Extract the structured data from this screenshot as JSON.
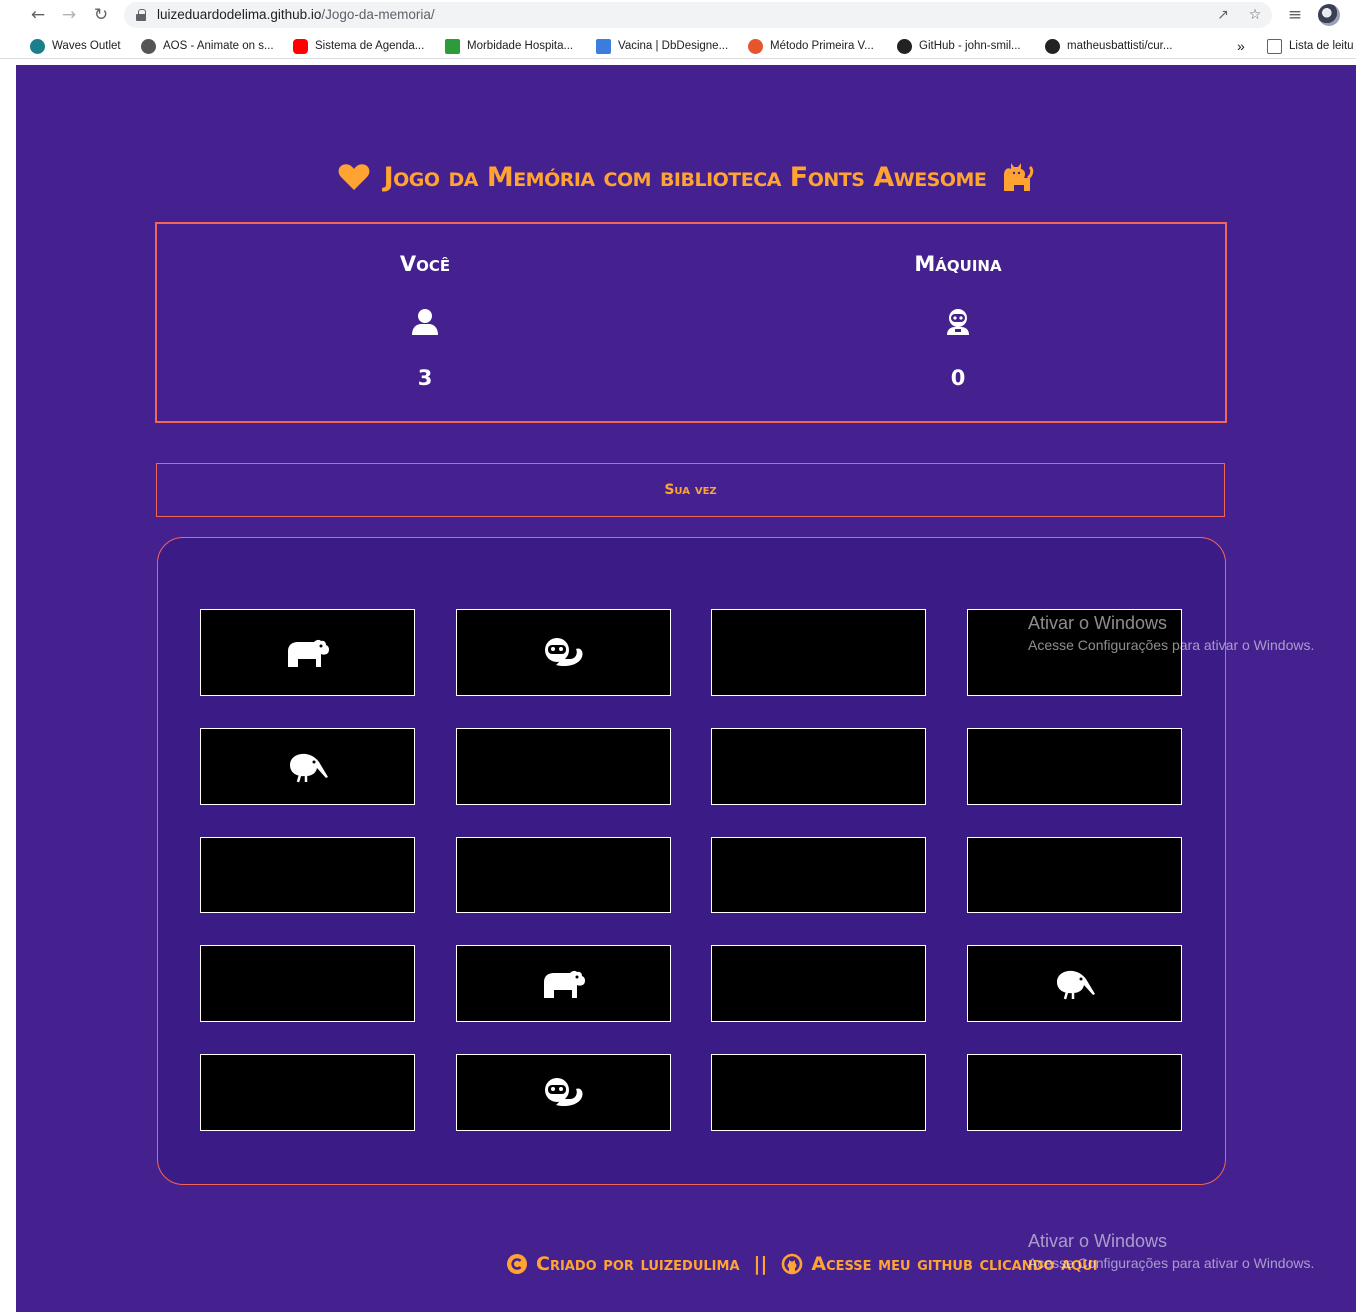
{
  "browser": {
    "url_host": "luizeduardodelima.github.io",
    "url_path": "/Jogo-da-memoria/",
    "bookmarks": [
      {
        "label": "Waves Outlet",
        "color": "#1a7f8a"
      },
      {
        "label": "AOS - Animate on s...",
        "color": "#555555"
      },
      {
        "label": "Sistema de Agenda...",
        "color": "#ff0000"
      },
      {
        "label": "Morbidade Hospita...",
        "color": "#2e9b3a"
      },
      {
        "label": "Vacina | DbDesigne...",
        "color": "#3b7ddd"
      },
      {
        "label": "Método Primeira V...",
        "color": "#e8542c"
      },
      {
        "label": "GitHub - john-smil...",
        "color": "#222222"
      },
      {
        "label": "matheusbattisti/cur...",
        "color": "#222222"
      }
    ],
    "overflow": "»",
    "reading_list": "Lista de leitu"
  },
  "page": {
    "title": "Jogo da Memória com biblioteca Fonts Awesome",
    "accent": "#ffa332",
    "border": "#f2665a",
    "background": "#44218e"
  },
  "score": {
    "player": {
      "name": "Você",
      "icon": "user-icon",
      "value": "3"
    },
    "machine": {
      "name": "Máquina",
      "icon": "robot-icon",
      "value": "0"
    }
  },
  "turn": "Sua vez",
  "cards": [
    {
      "icon": "hippo-icon"
    },
    {
      "icon": "otter-icon"
    },
    {
      "icon": ""
    },
    {
      "icon": ""
    },
    {
      "icon": "kiwi-bird-icon"
    },
    {
      "icon": ""
    },
    {
      "icon": ""
    },
    {
      "icon": ""
    },
    {
      "icon": ""
    },
    {
      "icon": ""
    },
    {
      "icon": ""
    },
    {
      "icon": ""
    },
    {
      "icon": ""
    },
    {
      "icon": "hippo-icon"
    },
    {
      "icon": ""
    },
    {
      "icon": "kiwi-bird-icon"
    },
    {
      "icon": ""
    },
    {
      "icon": "otter-icon"
    },
    {
      "icon": ""
    },
    {
      "icon": ""
    }
  ],
  "footer": {
    "credit": "Criado por luizedulima",
    "separator": "||",
    "github": "Acesse meu github clicando aqui"
  },
  "watermark": {
    "title": "Ativar o Windows",
    "subtitle": "Acesse Configurações para ativar o Windows."
  }
}
